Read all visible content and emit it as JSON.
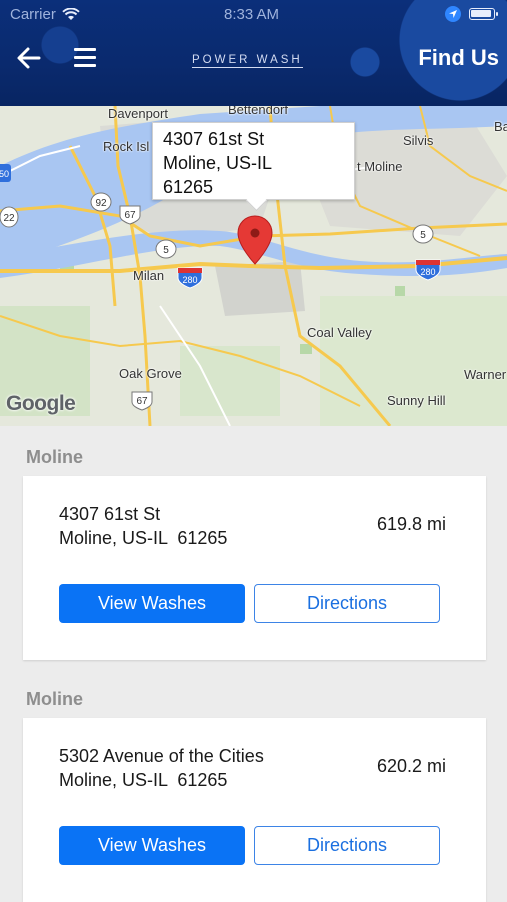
{
  "status_bar": {
    "carrier": "Carrier",
    "time": "8:33 AM"
  },
  "header": {
    "logo": "POWER WASH",
    "title": "Find Us"
  },
  "map": {
    "callout": {
      "line1": "4307 61st St",
      "line2": "Moline, US-IL",
      "line3": "61265"
    },
    "labels": {
      "davenport": "Davenport",
      "bettendorf": "Bettendorf",
      "rock_island": "Rock Isl",
      "silvis": "Silvis",
      "east_moline": "t Moline",
      "milan": "Milan",
      "coal_valley": "Coal Valley",
      "oak_grove": "Oak Grove",
      "sunny_hill": "Sunny Hill",
      "warner": "Warner",
      "ba": "Ba"
    },
    "shields": {
      "s92": "92",
      "s67": "67",
      "s5a": "5",
      "s5b": "5",
      "s280a": "280",
      "s280b": "280",
      "s22": "22",
      "s67b": "67",
      "s50": "50"
    },
    "attribution": "Google"
  },
  "locations": [
    {
      "section": "Moline",
      "address": "4307 61st St\nMoline, US-IL  61265",
      "distance": "619.8 mi",
      "primary_label": "View Washes",
      "secondary_label": "Directions"
    },
    {
      "section": "Moline",
      "address": "5302 Avenue of the Cities\nMoline, US-IL  61265",
      "distance": "620.2 mi",
      "primary_label": "View Washes",
      "secondary_label": "Directions"
    }
  ]
}
